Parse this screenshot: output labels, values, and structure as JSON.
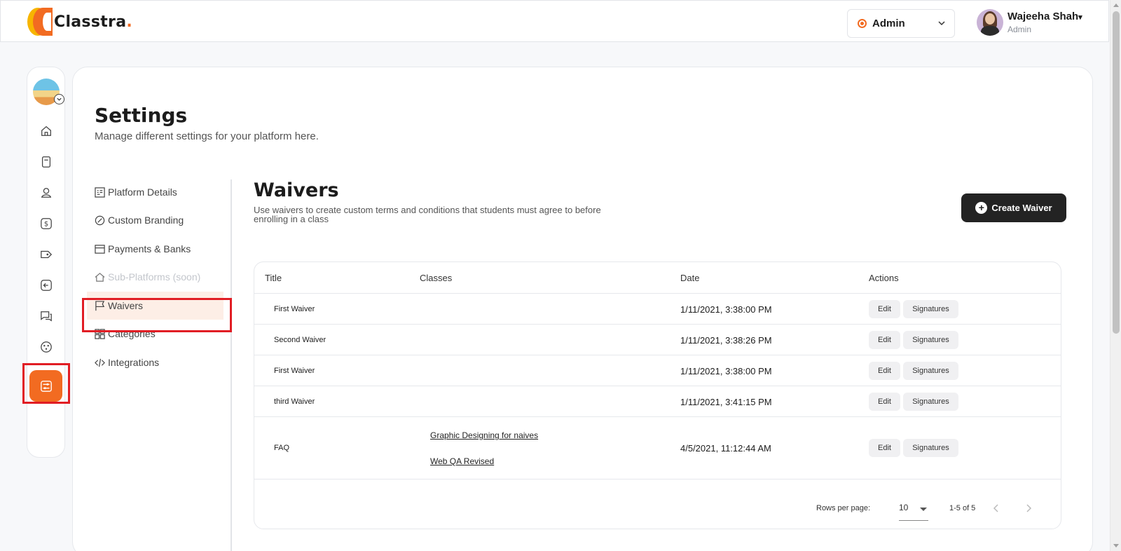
{
  "header": {
    "logo_text": "Classtra",
    "logo_dot": ".",
    "role_select": {
      "value": "Admin"
    },
    "user": {
      "name": "Wajeeha Shah",
      "role": "Admin"
    }
  },
  "rail": {
    "items": [
      "avatar",
      "home-icon",
      "book-icon",
      "users-icon",
      "dollar-icon",
      "tag-icon",
      "logout-icon",
      "chat-icon",
      "palette-icon",
      "settings-icon"
    ],
    "active": "settings-icon"
  },
  "page": {
    "title": "Settings",
    "subtitle": "Manage different settings for your platform here."
  },
  "settings_nav": {
    "items": [
      {
        "label": "Platform Details",
        "icon": "platform-icon",
        "state": "normal"
      },
      {
        "label": "Custom Branding",
        "icon": "branding-icon",
        "state": "normal"
      },
      {
        "label": "Payments & Banks",
        "icon": "card-icon",
        "state": "normal"
      },
      {
        "label": "Sub-Platforms (soon)",
        "icon": "house-icon",
        "state": "disabled"
      },
      {
        "label": "Waivers",
        "icon": "flag-icon",
        "state": "active"
      },
      {
        "label": "Categories",
        "icon": "grid-icon",
        "state": "normal"
      },
      {
        "label": "Integrations",
        "icon": "code-icon",
        "state": "normal"
      }
    ]
  },
  "waivers": {
    "title": "Waivers",
    "description": "Use waivers to create custom terms and conditions that students must agree to before enrolling in a class",
    "create_label": "Create Waiver",
    "columns": [
      "Title",
      "Classes",
      "Date",
      "Actions"
    ],
    "rows": [
      {
        "title": "First Waiver",
        "classes": [],
        "date": "1/11/2021, 3:38:00 PM"
      },
      {
        "title": "Second Waiver",
        "classes": [],
        "date": "1/11/2021, 3:38:26 PM"
      },
      {
        "title": "First Waiver",
        "classes": [],
        "date": "1/11/2021, 3:38:00 PM"
      },
      {
        "title": "third Waiver",
        "classes": [],
        "date": "1/11/2021, 3:41:15 PM"
      },
      {
        "title": "FAQ",
        "classes": [
          "Graphic Designing for naives",
          "Web QA Revised"
        ],
        "date": "4/5/2021, 11:12:44 AM"
      }
    ],
    "action_edit": "Edit",
    "action_signatures": "Signatures",
    "pagination": {
      "rows_per_page_label": "Rows per page:",
      "rows_per_page": "10",
      "range": "1-5 of 5"
    }
  },
  "colors": {
    "accent": "#f26b21",
    "dark_button": "#232323",
    "highlight": "#e11d24"
  }
}
